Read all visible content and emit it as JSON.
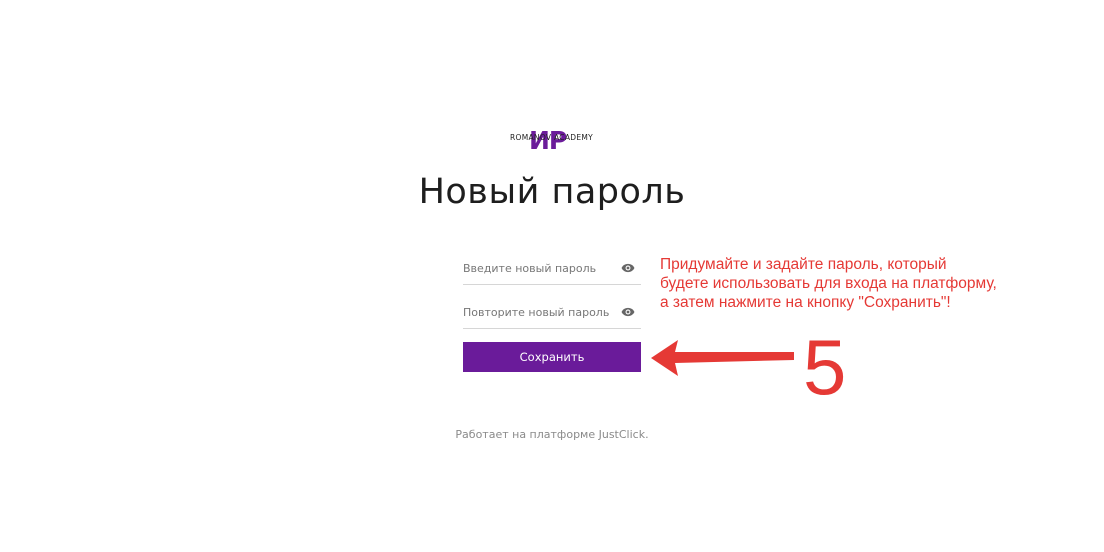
{
  "logo": {
    "mark": "ИР",
    "text": "ROMANOV ACADEMY"
  },
  "page": {
    "title": "Новый пароль"
  },
  "form": {
    "new_password_placeholder": "Введите новый пароль",
    "repeat_password_placeholder": "Повторите новый пароль",
    "save_label": "Сохранить"
  },
  "footer": {
    "note": "Работает на платформе JustClick."
  },
  "annotation": {
    "lines": [
      "Придумайте и задайте пароль, который",
      "будете использовать для входа на платформу,",
      "а затем нажмите на кнопку \"Сохранить\"!"
    ],
    "step_number": "5"
  },
  "colors": {
    "brand": "#6a1b9a",
    "annotation": "#e53935",
    "title": "#1e1e1e",
    "footer_text": "#8a8a8a"
  },
  "icons": {
    "toggle_visibility": "eye-icon",
    "pointer": "arrow-left-icon"
  }
}
